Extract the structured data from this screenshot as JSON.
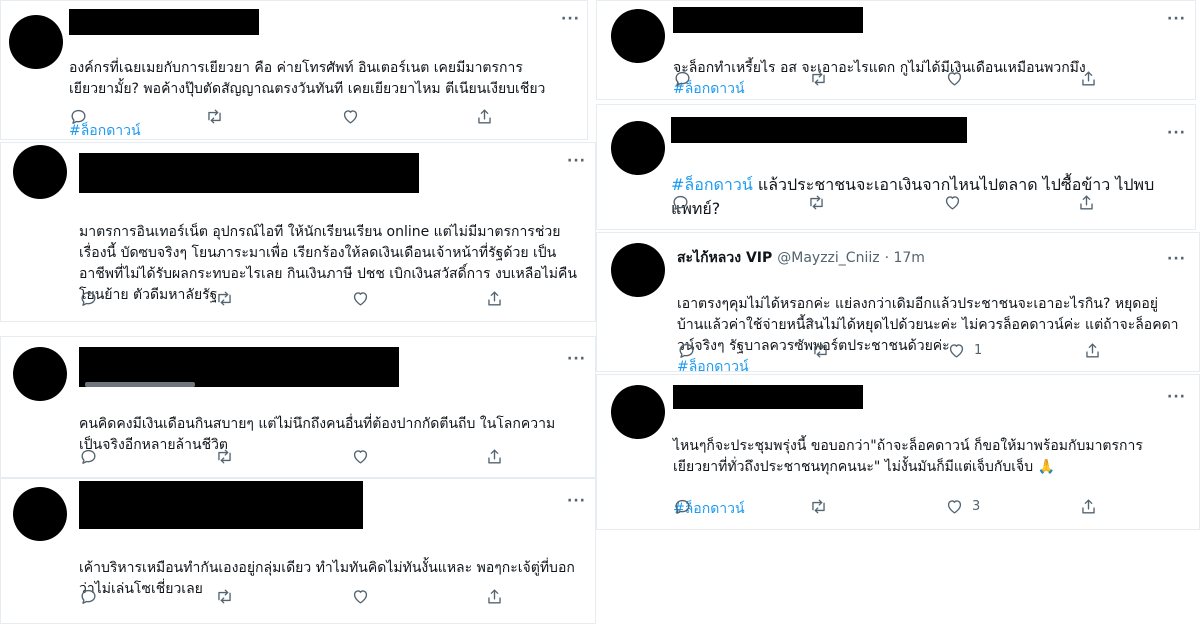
{
  "tweets": [
    {
      "id": "t1",
      "text": "องค์กรที่เฉยเมยกับการเยียวยา คือ ค่ายโทรศัพท์ อินเตอร์เนต เคยมีมาตรการ\nเยียวยามั้ย? พอค้างปุ๊บตัดสัญญาณตรงวันทันที เคยเยียวยาไหม ตีเนียนเงียบเชียว",
      "hashtag": "#ล็อกดาวน์",
      "likes": "",
      "more": "···"
    },
    {
      "id": "t2",
      "text": "มาตรการอินเทอร์เน็ต อุปกรณ์ไอที ให้นักเรียนเรียน online แต่ไม่มีมาตรการช่วย\nเรื่องนี้ บัดซบจริงๆ โยนภาระมาเพื่อ เรียกร้องให้ลดเงินเดือนเจ้าหน้าที่รัฐด้วย เป็น\nอาชีพที่ไม่ได้รับผลกระทบอะไรเลย กินเงินภาษี ปชช เบิกเงินสวัสดิ์การ งบเหลือไม่คืน\nโยนย้าย ตัวดีมหาลัยรัฐ",
      "more": "···"
    },
    {
      "id": "t3",
      "text": "คนคิดคงมีเงินเดือนกินสบายๆ แต่ไม่นึกถึงคนอื่นที่ต้องปากกัดตีนถีบ ในโลกความ\nเป็นจริงอีกหลายล้านชีวิต",
      "more": "···"
    },
    {
      "id": "t4",
      "text": "เค้าบริหารเหมือนทำกันเองอยู่กลุ่มเดียว ทำไมทันคิดไม่ทันงั้นแหละ พอๆกะเจ้ตู่ที่บอก\nว่าไม่เล่นโซเชี่ยวเลย",
      "more": "···"
    },
    {
      "id": "t5",
      "text": "จะล็อกทำเหรี้ยไร อส จะเอาอะไรแดก กูไม่ได้มีเงินเดือนเหมือนพวกมึง",
      "hashtag": "#ล็อกดาวน์",
      "more": "···"
    },
    {
      "id": "t6",
      "hashtag": "#ล็อกดาวน์",
      "text": " แล้วประชาชนจะเอาเงินจากไหนไปตลาด ไปซื้อข้าว ไปพบแพทย์?",
      "more": "···"
    },
    {
      "id": "t7",
      "username": "สะไก้หลวง VIP",
      "handle": "@Mayzzi_Cniiz",
      "time": "· 17m",
      "text": "เอาตรงๆคุมไม่ได้หรอกค่ะ แย่ลงกว่าเดิมอีกแล้วประชาชนจะเอาอะไรกิน? หยุดอยู่\nบ้านแล้วค่าใช้จ่ายหนี้สินไม่ได้หยุดไปด้วยนะค่ะ  ไม่ควรล็อคดาวน์ค่ะ แต่ถ้าจะล็อคดา\nวน์จริงๆ รัฐบาลควรซัพพอร์ตประชาชนด้วยค่ะ",
      "hashtag": "#ล็อกดาวน์",
      "likes": "1",
      "more": "···"
    },
    {
      "id": "t8",
      "text": "ไหนๆก็จะประชุมพรุ่งนี้ ขอบอกว่า\"ถ้าจะล็อคดาวน์ ก็ขอให้มาพร้อมกับมาตรการ\nเยียวยาที่ทั่วถึงประชาชนทุกคนนะ\" ไม่งั้นมันก็มีแต่เจ็บกับเจ็บ 🙏",
      "hashtag": "#ล็อกดาวน์",
      "likes": "3",
      "more": "···"
    }
  ],
  "icons": {
    "reply": "reply-icon",
    "retweet": "retweet-icon",
    "like": "heart-icon",
    "share": "share-icon",
    "more": "more-icon"
  },
  "colors": {
    "hashtag": "#1d9bf0",
    "icon": "#536471",
    "redaction": "#000000"
  }
}
